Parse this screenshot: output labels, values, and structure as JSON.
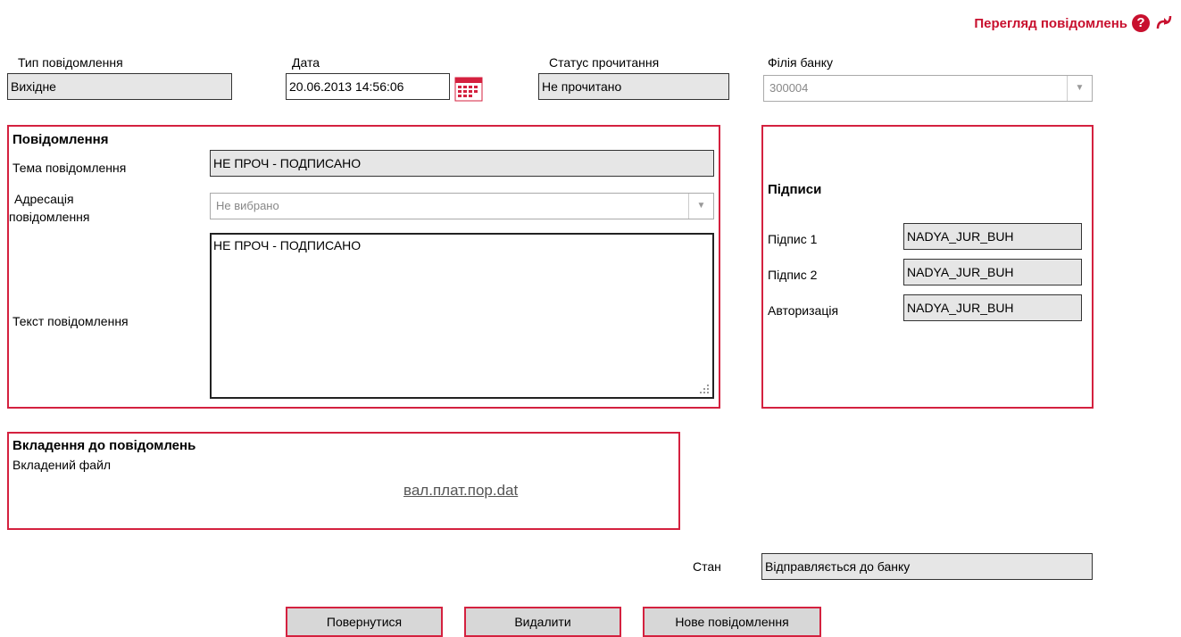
{
  "header": {
    "title": "Перегляд повідомлень"
  },
  "top": {
    "type_label": "Тип повідомлення",
    "type_value": "Вихідне",
    "date_label": "Дата",
    "date_value": "20.06.2013 14:56:06",
    "read_status_label": "Статус прочитання",
    "read_status_value": "Не прочитано",
    "branch_label": "Філія банку",
    "branch_value": "300004"
  },
  "message": {
    "section_title": "Повідомлення",
    "subject_label": "Тема повідомлення",
    "subject_value": "НЕ ПРОЧ - ПОДПИСАНО",
    "address_label_line1": "Адресація",
    "address_label_line2": "повідомлення",
    "address_value": "Не вибрано",
    "text_label": "Текст повідомлення",
    "text_value": "НЕ ПРОЧ - ПОДПИСАНО"
  },
  "signatures": {
    "title": "Підписи",
    "items": [
      {
        "label": "Підпис 1",
        "value": "NADYA_JUR_BUH"
      },
      {
        "label": "Підпис 2",
        "value": "NADYA_JUR_BUH"
      },
      {
        "label": "Авторизація",
        "value": "NADYA_JUR_BUH"
      }
    ]
  },
  "attachments": {
    "title": "Вкладення до повідомлень",
    "file_label": "Вкладений файл",
    "file_name": "вал.плат.пор.dat"
  },
  "state": {
    "label": "Стан",
    "value": "Відправляється до банку"
  },
  "buttons": {
    "back": "Повернутися",
    "delete": "Видалити",
    "new_message": "Нове повідомлення"
  },
  "icons": {
    "help": "help-icon",
    "refresh": "refresh-icon",
    "calendar": "calendar-icon"
  },
  "colors": {
    "accent": "#d4213f",
    "field_bg": "#e6e6e6"
  }
}
